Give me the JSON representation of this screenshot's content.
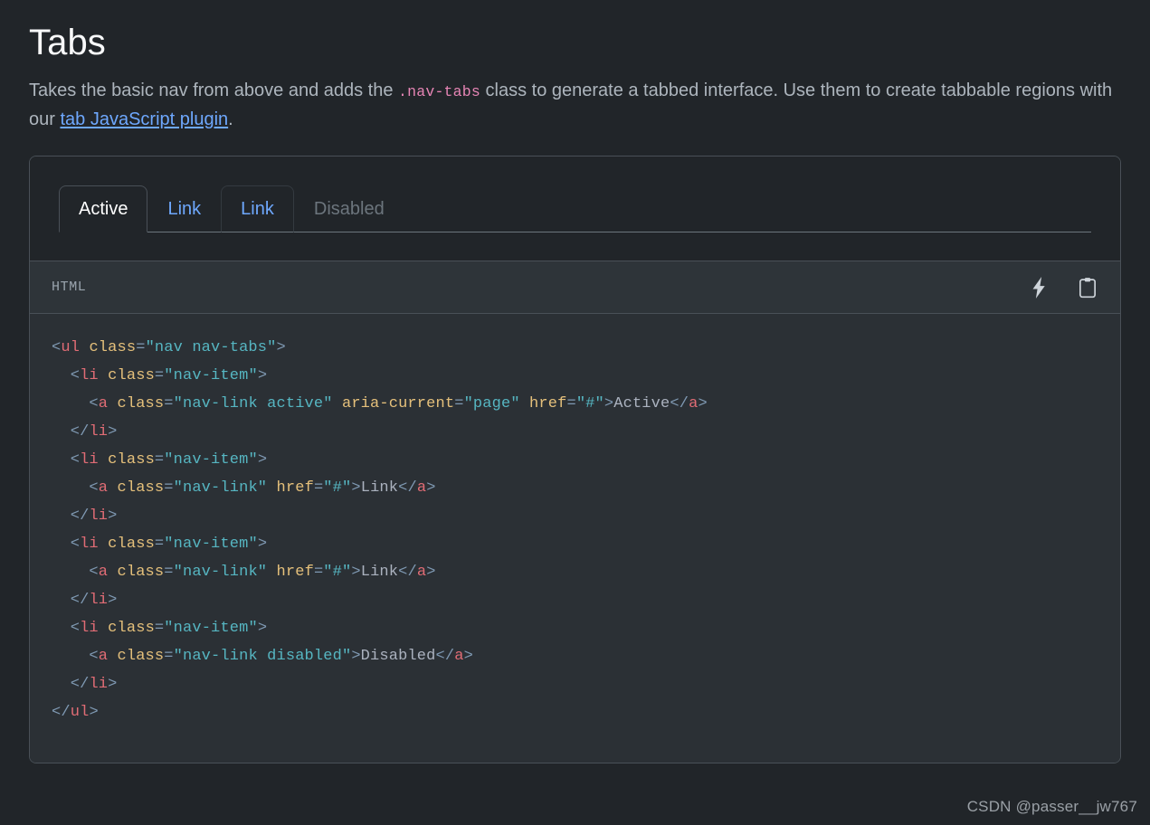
{
  "page": {
    "title": "Tabs",
    "lead": {
      "part1": "Takes the basic nav from above and adds the ",
      "code": ".nav-tabs",
      "part2": " class to generate a tabbed interface. Use them to create tabbable regions with our ",
      "link": "tab JavaScript plugin",
      "part3": "."
    }
  },
  "tabs": [
    {
      "label": "Active",
      "state": "active"
    },
    {
      "label": "Link",
      "state": "normal"
    },
    {
      "label": "Link",
      "state": "hovered"
    },
    {
      "label": "Disabled",
      "state": "disabled"
    }
  ],
  "code_panel": {
    "language": "HTML",
    "actions": [
      {
        "name": "lightning-icon",
        "title": "Toggle code example"
      },
      {
        "name": "clipboard-icon",
        "title": "Copy to clipboard"
      }
    ],
    "lines": [
      [
        {
          "t": "punc",
          "v": "<"
        },
        {
          "t": "tag",
          "v": "ul"
        },
        {
          "t": "text",
          "v": " "
        },
        {
          "t": "attr",
          "v": "class"
        },
        {
          "t": "punc",
          "v": "="
        },
        {
          "t": "val",
          "v": "\"nav nav-tabs\""
        },
        {
          "t": "punc",
          "v": ">"
        }
      ],
      [
        {
          "t": "text",
          "v": "  "
        },
        {
          "t": "punc",
          "v": "<"
        },
        {
          "t": "tag",
          "v": "li"
        },
        {
          "t": "text",
          "v": " "
        },
        {
          "t": "attr",
          "v": "class"
        },
        {
          "t": "punc",
          "v": "="
        },
        {
          "t": "val",
          "v": "\"nav-item\""
        },
        {
          "t": "punc",
          "v": ">"
        }
      ],
      [
        {
          "t": "text",
          "v": "    "
        },
        {
          "t": "punc",
          "v": "<"
        },
        {
          "t": "tag",
          "v": "a"
        },
        {
          "t": "text",
          "v": " "
        },
        {
          "t": "attr",
          "v": "class"
        },
        {
          "t": "punc",
          "v": "="
        },
        {
          "t": "val",
          "v": "\"nav-link active\""
        },
        {
          "t": "text",
          "v": " "
        },
        {
          "t": "attr",
          "v": "aria-current"
        },
        {
          "t": "punc",
          "v": "="
        },
        {
          "t": "val",
          "v": "\"page\""
        },
        {
          "t": "text",
          "v": " "
        },
        {
          "t": "attr",
          "v": "href"
        },
        {
          "t": "punc",
          "v": "="
        },
        {
          "t": "val",
          "v": "\"#\""
        },
        {
          "t": "punc",
          "v": ">"
        },
        {
          "t": "text",
          "v": "Active"
        },
        {
          "t": "punc",
          "v": "</"
        },
        {
          "t": "tag",
          "v": "a"
        },
        {
          "t": "punc",
          "v": ">"
        }
      ],
      [
        {
          "t": "text",
          "v": "  "
        },
        {
          "t": "punc",
          "v": "</"
        },
        {
          "t": "tag",
          "v": "li"
        },
        {
          "t": "punc",
          "v": ">"
        }
      ],
      [
        {
          "t": "text",
          "v": "  "
        },
        {
          "t": "punc",
          "v": "<"
        },
        {
          "t": "tag",
          "v": "li"
        },
        {
          "t": "text",
          "v": " "
        },
        {
          "t": "attr",
          "v": "class"
        },
        {
          "t": "punc",
          "v": "="
        },
        {
          "t": "val",
          "v": "\"nav-item\""
        },
        {
          "t": "punc",
          "v": ">"
        }
      ],
      [
        {
          "t": "text",
          "v": "    "
        },
        {
          "t": "punc",
          "v": "<"
        },
        {
          "t": "tag",
          "v": "a"
        },
        {
          "t": "text",
          "v": " "
        },
        {
          "t": "attr",
          "v": "class"
        },
        {
          "t": "punc",
          "v": "="
        },
        {
          "t": "val",
          "v": "\"nav-link\""
        },
        {
          "t": "text",
          "v": " "
        },
        {
          "t": "attr",
          "v": "href"
        },
        {
          "t": "punc",
          "v": "="
        },
        {
          "t": "val",
          "v": "\"#\""
        },
        {
          "t": "punc",
          "v": ">"
        },
        {
          "t": "text",
          "v": "Link"
        },
        {
          "t": "punc",
          "v": "</"
        },
        {
          "t": "tag",
          "v": "a"
        },
        {
          "t": "punc",
          "v": ">"
        }
      ],
      [
        {
          "t": "text",
          "v": "  "
        },
        {
          "t": "punc",
          "v": "</"
        },
        {
          "t": "tag",
          "v": "li"
        },
        {
          "t": "punc",
          "v": ">"
        }
      ],
      [
        {
          "t": "text",
          "v": "  "
        },
        {
          "t": "punc",
          "v": "<"
        },
        {
          "t": "tag",
          "v": "li"
        },
        {
          "t": "text",
          "v": " "
        },
        {
          "t": "attr",
          "v": "class"
        },
        {
          "t": "punc",
          "v": "="
        },
        {
          "t": "val",
          "v": "\"nav-item\""
        },
        {
          "t": "punc",
          "v": ">"
        }
      ],
      [
        {
          "t": "text",
          "v": "    "
        },
        {
          "t": "punc",
          "v": "<"
        },
        {
          "t": "tag",
          "v": "a"
        },
        {
          "t": "text",
          "v": " "
        },
        {
          "t": "attr",
          "v": "class"
        },
        {
          "t": "punc",
          "v": "="
        },
        {
          "t": "val",
          "v": "\"nav-link\""
        },
        {
          "t": "text",
          "v": " "
        },
        {
          "t": "attr",
          "v": "href"
        },
        {
          "t": "punc",
          "v": "="
        },
        {
          "t": "val",
          "v": "\"#\""
        },
        {
          "t": "punc",
          "v": ">"
        },
        {
          "t": "text",
          "v": "Link"
        },
        {
          "t": "punc",
          "v": "</"
        },
        {
          "t": "tag",
          "v": "a"
        },
        {
          "t": "punc",
          "v": ">"
        }
      ],
      [
        {
          "t": "text",
          "v": "  "
        },
        {
          "t": "punc",
          "v": "</"
        },
        {
          "t": "tag",
          "v": "li"
        },
        {
          "t": "punc",
          "v": ">"
        }
      ],
      [
        {
          "t": "text",
          "v": "  "
        },
        {
          "t": "punc",
          "v": "<"
        },
        {
          "t": "tag",
          "v": "li"
        },
        {
          "t": "text",
          "v": " "
        },
        {
          "t": "attr",
          "v": "class"
        },
        {
          "t": "punc",
          "v": "="
        },
        {
          "t": "val",
          "v": "\"nav-item\""
        },
        {
          "t": "punc",
          "v": ">"
        }
      ],
      [
        {
          "t": "text",
          "v": "    "
        },
        {
          "t": "punc",
          "v": "<"
        },
        {
          "t": "tag",
          "v": "a"
        },
        {
          "t": "text",
          "v": " "
        },
        {
          "t": "attr",
          "v": "class"
        },
        {
          "t": "punc",
          "v": "="
        },
        {
          "t": "val",
          "v": "\"nav-link disabled\""
        },
        {
          "t": "punc",
          "v": ">"
        },
        {
          "t": "text",
          "v": "Disabled"
        },
        {
          "t": "punc",
          "v": "</"
        },
        {
          "t": "tag",
          "v": "a"
        },
        {
          "t": "punc",
          "v": ">"
        }
      ],
      [
        {
          "t": "text",
          "v": "  "
        },
        {
          "t": "punc",
          "v": "</"
        },
        {
          "t": "tag",
          "v": "li"
        },
        {
          "t": "punc",
          "v": ">"
        }
      ],
      [
        {
          "t": "punc",
          "v": "</"
        },
        {
          "t": "tag",
          "v": "ul"
        },
        {
          "t": "punc",
          "v": ">"
        }
      ]
    ]
  },
  "watermark": "CSDN @passer__jw767",
  "colors": {
    "page_bg": "#212529",
    "card_border": "#495057",
    "link": "#6ea8fe",
    "inline_code": "#e685b5",
    "code_bg": "#2b3035",
    "code_header_bg": "#2e3439",
    "tag": "#e06c75",
    "attr": "#e5c07b",
    "value": "#56b6c2",
    "punctuation": "#7f99b3"
  }
}
